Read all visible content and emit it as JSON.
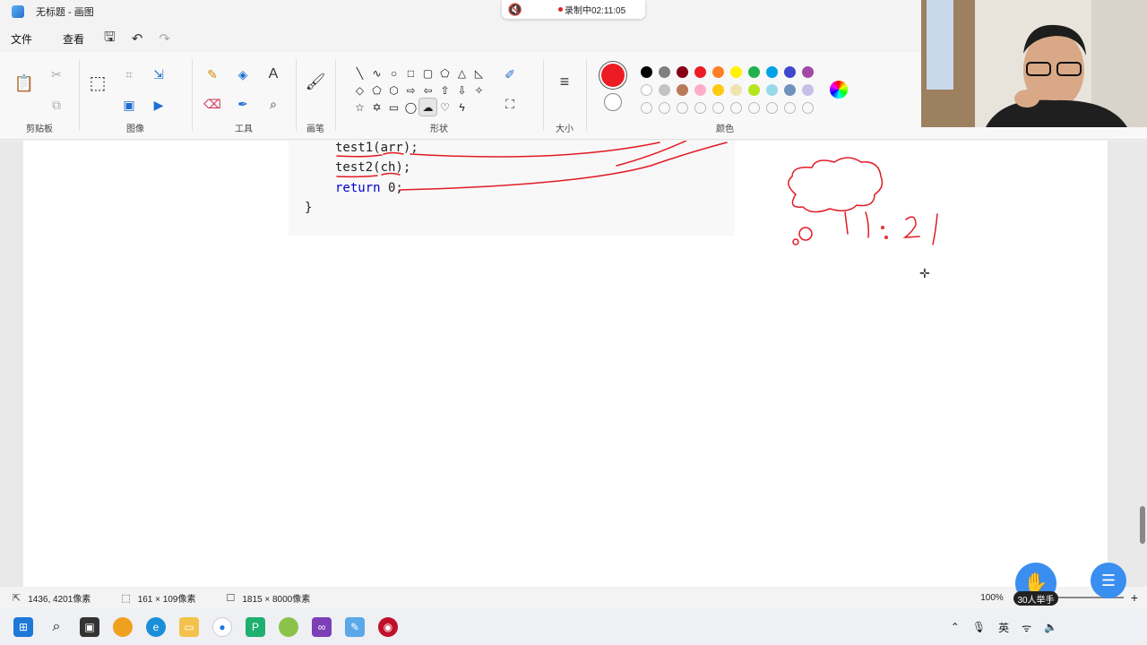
{
  "window": {
    "title": "无标题 - 画图"
  },
  "recording": {
    "label": "录制中02:11:05"
  },
  "menu": {
    "file": "文件",
    "view": "查看"
  },
  "ribbon": {
    "groups": {
      "clipboard": "剪贴板",
      "image": "图像",
      "tools": "工具",
      "brushes": "画笔",
      "shapes": "形状",
      "size": "大小",
      "colors": "颜色"
    },
    "text_tool": "A",
    "primary_color": "#ed1c24",
    "palette_row1": [
      "#000000",
      "#7f7f7f",
      "#880015",
      "#ed1c24",
      "#ff7f27",
      "#fff200",
      "#22b14c",
      "#00a2e8",
      "#3f48cc",
      "#a349a4"
    ],
    "palette_row2": [
      "#ffffff",
      "#c3c3c3",
      "#b97a57",
      "#ffaec9",
      "#ffc90e",
      "#efe4b0",
      "#b5e61d",
      "#99d9ea",
      "#7092be",
      "#c8bfe7"
    ]
  },
  "code": {
    "line1": "test1(arr);",
    "line2": "test2(ch);",
    "line3_kw": "return",
    "line3_rest": " 0;",
    "line4": "}"
  },
  "sketch": {
    "handwriting": "1 : 2 1"
  },
  "status": {
    "cursor_pos": "1436, 4201像素",
    "selection_size": "161 × 109像素",
    "canvas_size": "1815 × 8000像素",
    "zoom": "100%"
  },
  "overlay": {
    "raise_hand": "30人举手"
  },
  "tray": {
    "ime": "英"
  }
}
